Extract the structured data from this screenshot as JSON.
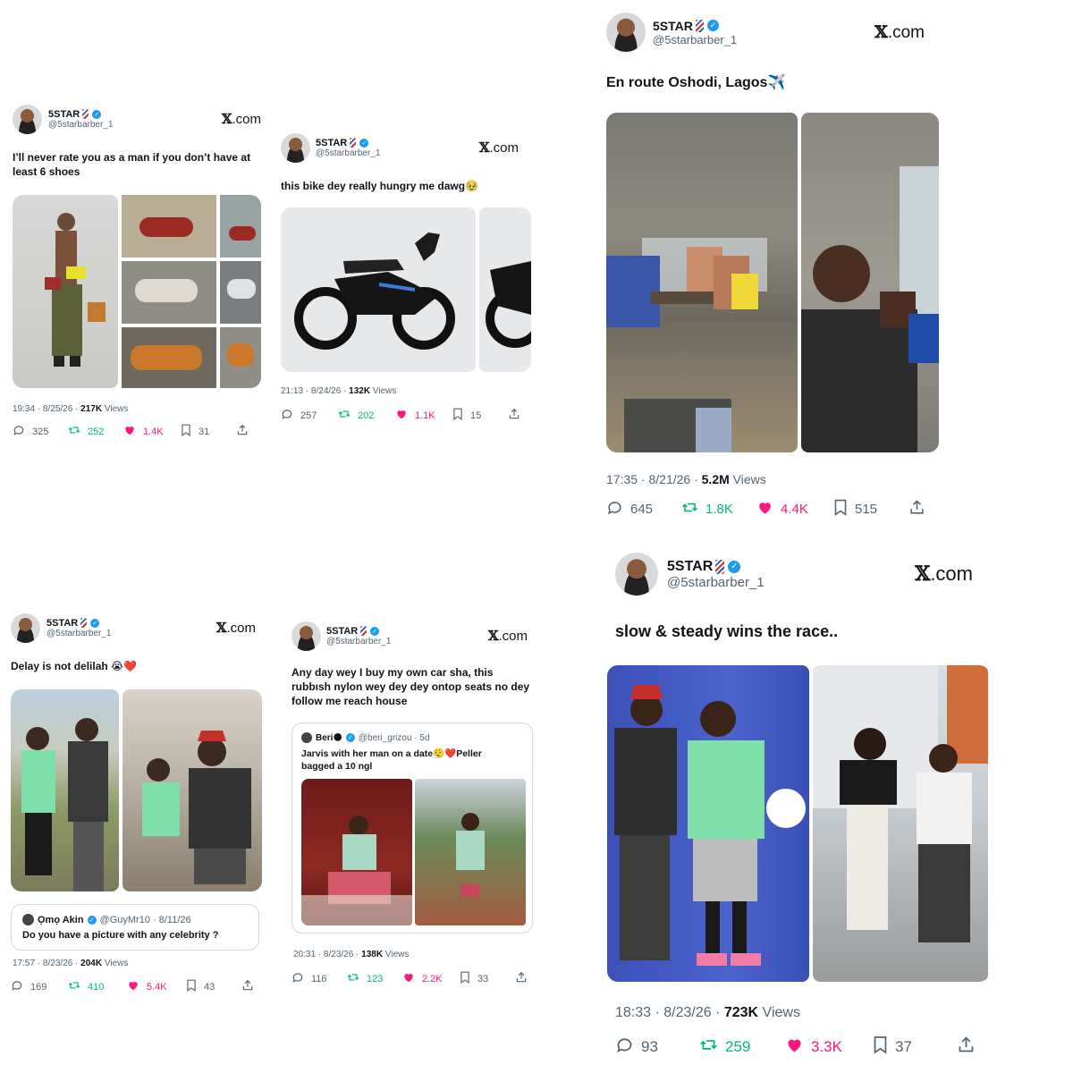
{
  "account": {
    "name": "5STAR",
    "handle": "@5starbarber_1",
    "site": "X.com",
    "site_x": "𝕏",
    "site_rest": ".com"
  },
  "tweets": [
    {
      "text": "I’ll never rate you as a man if you don’t have at least 6 shoes",
      "time": "19:34 · 8/25/26 · ",
      "views": "217K",
      "views_label": " Views",
      "replies": "325",
      "retweets": "252",
      "likes": "1.4K",
      "bookmarks": "31"
    },
    {
      "text": "this bike dey really hungry me dawg🥹",
      "time": "21:13 · 8/24/26 · ",
      "views": "132K",
      "views_label": " Views",
      "replies": "257",
      "retweets": "202",
      "likes": "1.1K",
      "bookmarks": "15"
    },
    {
      "text": "En route Oshodi, Lagos✈️",
      "time": "17:35 · 8/21/26 · ",
      "views": "5.2M",
      "views_label": " Views",
      "replies": "645",
      "retweets": "1.8K",
      "likes": "4.4K",
      "bookmarks": "515"
    },
    {
      "text": "Delay is not delilah 😭❤️",
      "time": "17:57 · 8/23/26 · ",
      "views": "204K",
      "views_label": " Views",
      "replies": "169",
      "retweets": "410",
      "likes": "5.4K",
      "bookmarks": "43",
      "quote": {
        "name": "Ọmọ Akin",
        "handle": "@GuyMr10 · 8/11/26",
        "text": "Do you have a picture with any celebrity ?"
      }
    },
    {
      "text": "Any day wey I buy my own car sha, this rubbısh nylon wey dey dey ontop seats no dey follow me reach house",
      "time": "20:31 · 8/23/26 · ",
      "views": "138K",
      "views_label": " Views",
      "replies": "116",
      "retweets": "123",
      "likes": "2.2K",
      "bookmarks": "33",
      "quote": {
        "name": "Beri🌑",
        "handle": "@beri_grizou · 5d",
        "text": "Jarvis with her man on a date😮‍💨❤️Peller bagged a 10 ngl"
      }
    },
    {
      "text": "slow & steady wins the race..",
      "time": "18:33 · 8/23/26 · ",
      "views": "723K",
      "views_label": " Views",
      "replies": "93",
      "retweets": "259",
      "likes": "3.3K",
      "bookmarks": "37"
    }
  ],
  "icons": [
    "reply-icon",
    "retweet-icon",
    "like-icon",
    "bookmark-icon",
    "share-icon",
    "verified-icon",
    "barber-pole-icon"
  ],
  "colors": {
    "retweet": "#00ba7c",
    "like": "#f91880",
    "verified": "#1d9bf0",
    "muted": "#536471"
  }
}
